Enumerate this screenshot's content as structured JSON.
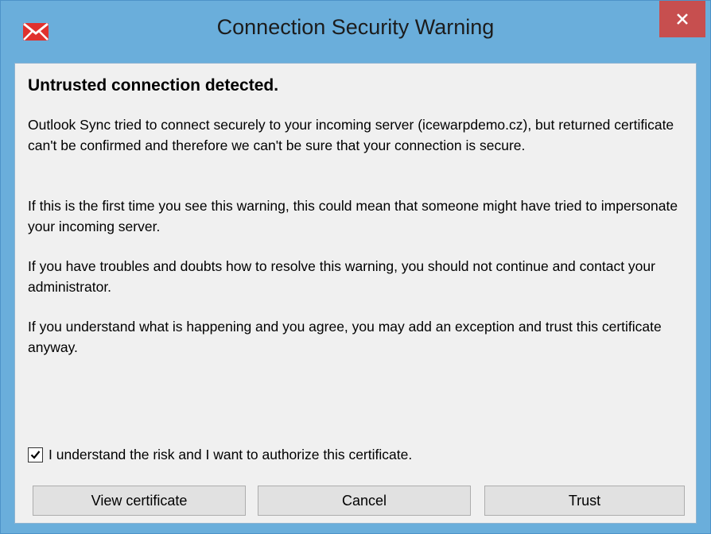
{
  "window": {
    "title": "Connection Security Warning",
    "app_icon": "envelope-icon",
    "close_icon": "close-icon"
  },
  "content": {
    "heading": "Untrusted connection detected.",
    "paragraphs": [
      "Outlook Sync tried to connect securely to your incoming server (icewarpdemo.cz), but returned certificate can't be confirmed and therefore we can't be sure that your connection is secure.",
      "If this is the first time you see this warning, this could mean that someone might have tried to impersonate your incoming server.",
      "If you have troubles and doubts how to resolve this warning, you should not continue and contact your administrator.",
      "If you understand what is happening and you agree, you may add an exception and trust this certificate anyway."
    ],
    "checkbox": {
      "label": "I understand the risk and I want to authorize this certificate.",
      "checked": true
    }
  },
  "buttons": {
    "view_certificate": "View certificate",
    "cancel": "Cancel",
    "trust": "Trust"
  },
  "colors": {
    "titlebar": "#6aaedb",
    "close_button": "#c74f4f",
    "client_background": "#f0f0f0",
    "button_background": "#e1e1e1"
  }
}
